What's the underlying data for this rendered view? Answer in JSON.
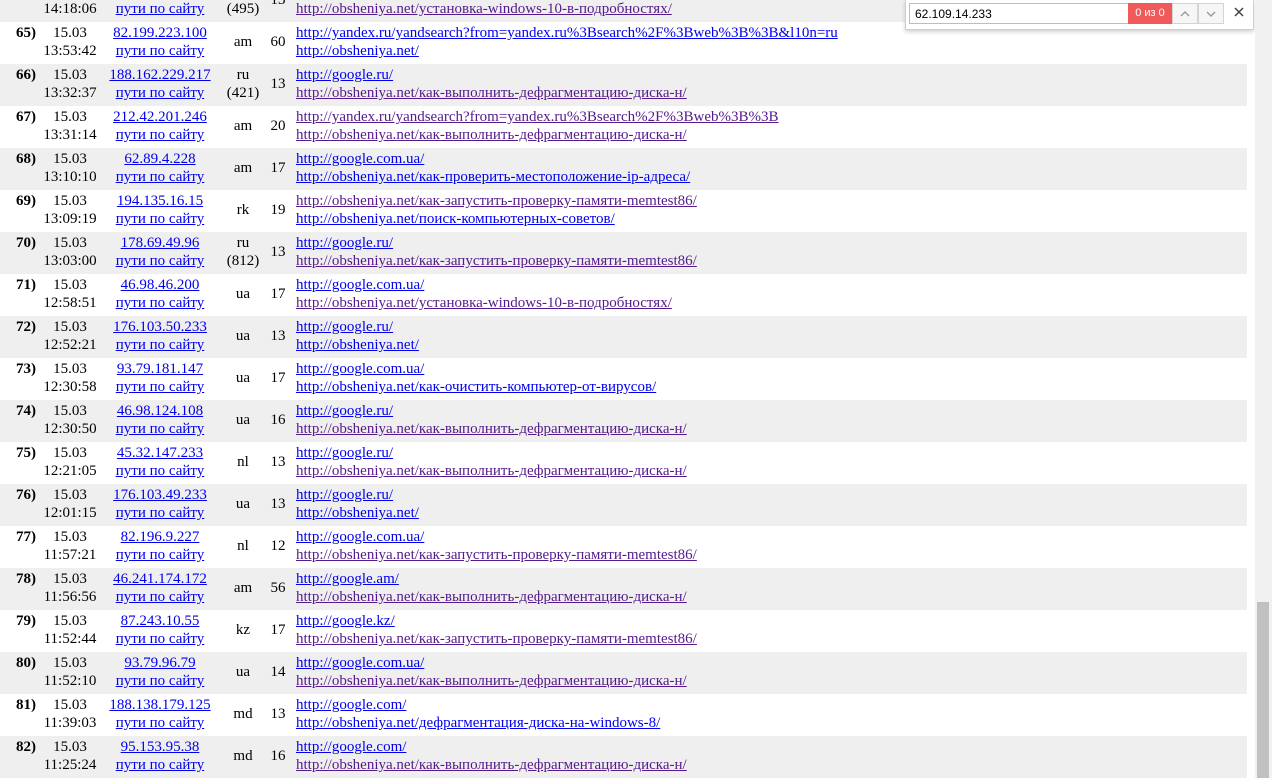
{
  "rows": [
    {
      "num": "",
      "date": "",
      "time": "14:18:06",
      "ip": "",
      "path": "пути по сайту",
      "cc": "",
      "cc_count": "(495)",
      "views": "13",
      "ref": "",
      "page": "http://obsheniya.net/установка-windows-10-в-подробностях/",
      "ref_visited": false,
      "page_visited": true
    },
    {
      "num": "65)",
      "date": "15.03",
      "time": "13:53:42",
      "ip": "82.199.223.100",
      "path": "пути по сайту",
      "cc": "am",
      "cc_count": "",
      "views": "60",
      "ref": "http://yandex.ru/yandsearch?from=yandex.ru%3Bsearch%2F%3Bweb%3B%3B&l10n=ru",
      "page": "http://obsheniya.net/",
      "ref_visited": false,
      "page_visited": false
    },
    {
      "num": "66)",
      "date": "15.03",
      "time": "13:32:37",
      "ip": "188.162.229.217",
      "path": "пути по сайту",
      "cc": "ru",
      "cc_count": "(421)",
      "views": "13",
      "ref": "http://google.ru/",
      "page": "http://obsheniya.net/как-выполнить-дефрагментацию-диска-н/",
      "ref_visited": false,
      "page_visited": true
    },
    {
      "num": "67)",
      "date": "15.03",
      "time": "13:31:14",
      "ip": "212.42.201.246",
      "path": "пути по сайту",
      "cc": "am",
      "cc_count": "",
      "views": "20",
      "ref": "http://yandex.ru/yandsearch?from=yandex.ru%3Bsearch%2F%3Bweb%3B%3B",
      "page": "http://obsheniya.net/как-выполнить-дефрагментацию-диска-н/",
      "ref_visited": true,
      "page_visited": true
    },
    {
      "num": "68)",
      "date": "15.03",
      "time": "13:10:10",
      "ip": "62.89.4.228",
      "path": "пути по сайту",
      "cc": "am",
      "cc_count": "",
      "views": "17",
      "ref": "http://google.com.ua/",
      "page": "http://obsheniya.net/как-проверить-местоположение-ip-адреса/",
      "ref_visited": false,
      "page_visited": false
    },
    {
      "num": "69)",
      "date": "15.03",
      "time": "13:09:19",
      "ip": "194.135.16.15",
      "path": "пути по сайту",
      "cc": "rk",
      "cc_count": "",
      "views": "19",
      "ref": "http://obsheniya.net/как-запустить-проверку-памяти-memtest86/",
      "page": "http://obsheniya.net/поиск-компьютерных-советов/",
      "ref_visited": true,
      "page_visited": false
    },
    {
      "num": "70)",
      "date": "15.03",
      "time": "13:03:00",
      "ip": "178.69.49.96",
      "path": "пути по сайту",
      "cc": "ru",
      "cc_count": "(812)",
      "views": "13",
      "ref": "http://google.ru/",
      "page": "http://obsheniya.net/как-запустить-проверку-памяти-memtest86/",
      "ref_visited": false,
      "page_visited": true
    },
    {
      "num": "71)",
      "date": "15.03",
      "time": "12:58:51",
      "ip": "46.98.46.200",
      "path": "пути по сайту",
      "cc": "ua",
      "cc_count": "",
      "views": "17",
      "ref": "http://google.com.ua/",
      "page": "http://obsheniya.net/установка-windows-10-в-подробностях/",
      "ref_visited": false,
      "page_visited": true
    },
    {
      "num": "72)",
      "date": "15.03",
      "time": "12:52:21",
      "ip": "176.103.50.233",
      "path": "пути по сайту",
      "cc": "ua",
      "cc_count": "",
      "views": "13",
      "ref": "http://google.ru/",
      "page": "http://obsheniya.net/",
      "ref_visited": false,
      "page_visited": false
    },
    {
      "num": "73)",
      "date": "15.03",
      "time": "12:30:58",
      "ip": "93.79.181.147",
      "path": "пути по сайту",
      "cc": "ua",
      "cc_count": "",
      "views": "17",
      "ref": "http://google.com.ua/",
      "page": "http://obsheniya.net/как-очистить-компьютер-от-вирусов/",
      "ref_visited": false,
      "page_visited": false
    },
    {
      "num": "74)",
      "date": "15.03",
      "time": "12:30:50",
      "ip": "46.98.124.108",
      "path": "пути по сайту",
      "cc": "ua",
      "cc_count": "",
      "views": "16",
      "ref": "http://google.ru/",
      "page": "http://obsheniya.net/как-выполнить-дефрагментацию-диска-н/",
      "ref_visited": false,
      "page_visited": true
    },
    {
      "num": "75)",
      "date": "15.03",
      "time": "12:21:05",
      "ip": "45.32.147.233",
      "path": "пути по сайту",
      "cc": "nl",
      "cc_count": "",
      "views": "13",
      "ref": "http://google.ru/",
      "page": "http://obsheniya.net/как-выполнить-дефрагментацию-диска-н/",
      "ref_visited": false,
      "page_visited": true
    },
    {
      "num": "76)",
      "date": "15.03",
      "time": "12:01:15",
      "ip": "176.103.49.233",
      "path": "пути по сайту",
      "cc": "ua",
      "cc_count": "",
      "views": "13",
      "ref": "http://google.ru/",
      "page": "http://obsheniya.net/",
      "ref_visited": false,
      "page_visited": false
    },
    {
      "num": "77)",
      "date": "15.03",
      "time": "11:57:21",
      "ip": "82.196.9.227",
      "path": "пути по сайту",
      "cc": "nl",
      "cc_count": "",
      "views": "12",
      "ref": "http://google.com.ua/",
      "page": "http://obsheniya.net/как-запустить-проверку-памяти-memtest86/",
      "ref_visited": false,
      "page_visited": true
    },
    {
      "num": "78)",
      "date": "15.03",
      "time": "11:56:56",
      "ip": "46.241.174.172",
      "path": "пути по сайту",
      "cc": "am",
      "cc_count": "",
      "views": "56",
      "ref": "http://google.am/",
      "page": "http://obsheniya.net/как-выполнить-дефрагментацию-диска-н/",
      "ref_visited": false,
      "page_visited": true
    },
    {
      "num": "79)",
      "date": "15.03",
      "time": "11:52:44",
      "ip": "87.243.10.55",
      "path": "пути по сайту",
      "cc": "kz",
      "cc_count": "",
      "views": "17",
      "ref": "http://google.kz/",
      "page": "http://obsheniya.net/как-запустить-проверку-памяти-memtest86/",
      "ref_visited": false,
      "page_visited": true
    },
    {
      "num": "80)",
      "date": "15.03",
      "time": "11:52:10",
      "ip": "93.79.96.79",
      "path": "пути по сайту",
      "cc": "ua",
      "cc_count": "",
      "views": "14",
      "ref": "http://google.com.ua/",
      "page": "http://obsheniya.net/как-выполнить-дефрагментацию-диска-н/",
      "ref_visited": false,
      "page_visited": true
    },
    {
      "num": "81)",
      "date": "15.03",
      "time": "11:39:03",
      "ip": "188.138.179.125",
      "path": "пути по сайту",
      "cc": "md",
      "cc_count": "",
      "views": "13",
      "ref": "http://google.com/",
      "page": "http://obsheniya.net/дефрагментация-диска-на-windows-8/",
      "ref_visited": false,
      "page_visited": false
    },
    {
      "num": "82)",
      "date": "15.03",
      "time": "11:25:24",
      "ip": "95.153.95.38",
      "path": "пути по сайту",
      "cc": "md",
      "cc_count": "",
      "views": "16",
      "ref": "http://google.com/",
      "page": "http://obsheniya.net/как-выполнить-дефрагментацию-диска-н/",
      "ref_visited": false,
      "page_visited": true
    }
  ],
  "findbar": {
    "query": "62.109.14.233",
    "match_count": "0 из 0",
    "prev_icon": "chevron-up-icon",
    "next_icon": "chevron-down-icon",
    "close_icon": "close-icon"
  },
  "colors": {
    "link": "#0000ee",
    "visited": "#551a8b",
    "row_alt": "#efefef",
    "no_match": "#f05a5a"
  }
}
